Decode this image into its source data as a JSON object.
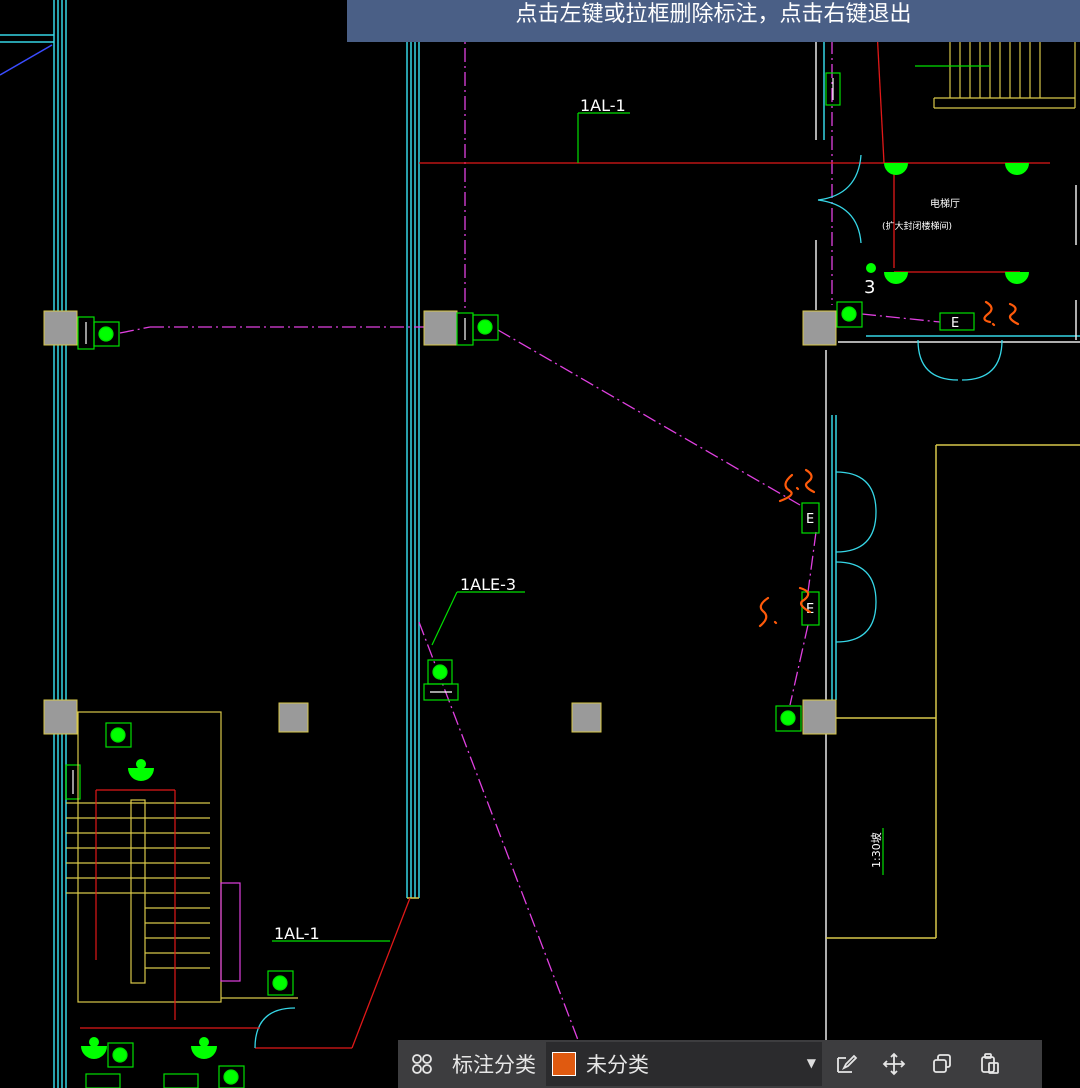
{
  "banner": {
    "text": "点击左键或拉框删除标注，点击右键退出"
  },
  "toolbar": {
    "category_label": "标注分类",
    "category_value": "未分类",
    "category_color": "#e05a10",
    "buttons": [
      "grid-icon",
      "edit-icon",
      "move-icon",
      "copy-icon",
      "paste-icon"
    ]
  },
  "drawing": {
    "labels": {
      "circuit_top": "1AL-1",
      "circuit_emergency": "1ALE-3",
      "circuit_bottom": "1AL-1",
      "room_name": "电梯厅",
      "room_note": "(扩大封闭楼梯间)",
      "slope_note": "1:30坡",
      "number_3": "3",
      "exit_sign": "E"
    },
    "markup": {
      "note_1": "3. 3",
      "note_2": "3. 3",
      "note_3": "3. 3",
      "color": "#ff5a0a"
    }
  }
}
